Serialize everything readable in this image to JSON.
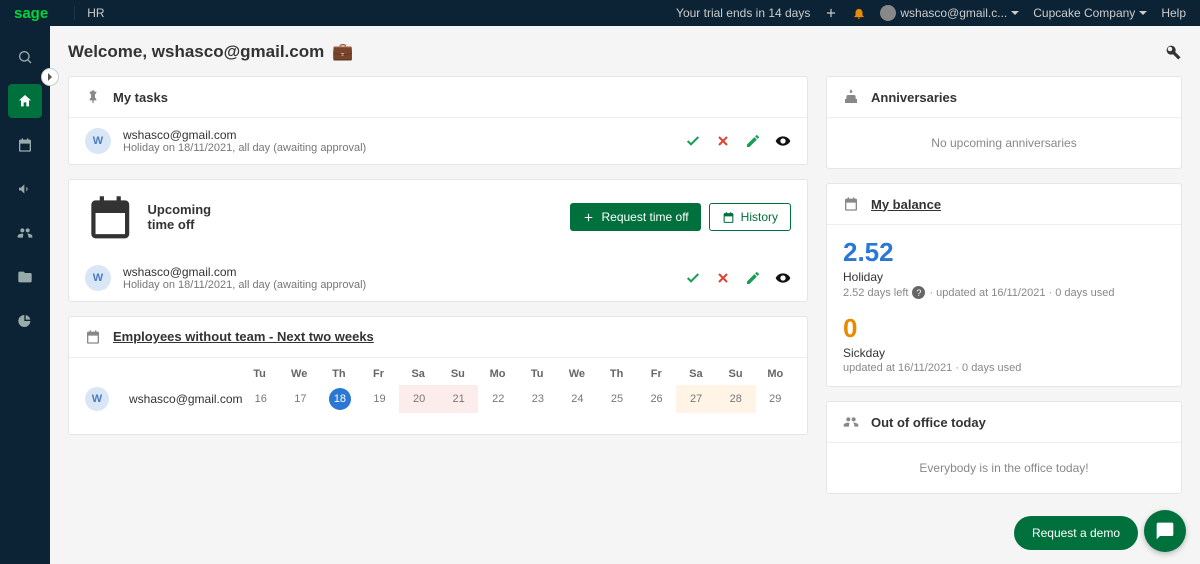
{
  "topbar": {
    "logo": "sage",
    "section": "HR",
    "trial": "Your trial ends in 14 days",
    "user_email": "wshasco@gmail.c...",
    "company": "Cupcake Company",
    "help": "Help"
  },
  "page": {
    "welcome": "Welcome, wshasco@gmail.com"
  },
  "my_tasks": {
    "title": "My tasks",
    "items": [
      {
        "avatar": "W",
        "email": "wshasco@gmail.com",
        "detail": "Holiday on 18/11/2021, all day (awaiting approval)"
      }
    ]
  },
  "upcoming": {
    "title": "Upcoming time off",
    "request_btn": "Request time off",
    "history_btn": "History",
    "items": [
      {
        "avatar": "W",
        "email": "wshasco@gmail.com",
        "detail": "Holiday on 18/11/2021, all day (awaiting approval)"
      }
    ]
  },
  "no_team": {
    "title": "Employees without team - Next two weeks",
    "employee": {
      "avatar": "W",
      "name": "wshasco@gmail.com"
    },
    "day_labels": [
      "Tu",
      "We",
      "Th",
      "Fr",
      "Sa",
      "Su",
      "Mo",
      "Tu",
      "We",
      "Th",
      "Fr",
      "Sa",
      "Su",
      "Mo"
    ],
    "day_numbers": [
      "16",
      "17",
      "18",
      "19",
      "20",
      "21",
      "22",
      "23",
      "24",
      "25",
      "26",
      "27",
      "28",
      "29"
    ],
    "today_index": 2,
    "weekend_indexes": [
      4,
      5,
      11,
      12
    ]
  },
  "anniversaries": {
    "title": "Anniversaries",
    "empty": "No upcoming anniversaries"
  },
  "balance": {
    "title": "My balance",
    "holiday_value": "2.52",
    "holiday_label": "Holiday",
    "holiday_sub_left": "2.52 days left",
    "holiday_sub_update": "· updated at 16/11/2021 · 0 days used",
    "sick_value": "0",
    "sick_label": "Sickday",
    "sick_sub": "updated at 16/11/2021 · 0 days used"
  },
  "out_of_office": {
    "title": "Out of office today",
    "empty": "Everybody is in the office today!"
  },
  "floating": {
    "demo": "Request a demo"
  }
}
